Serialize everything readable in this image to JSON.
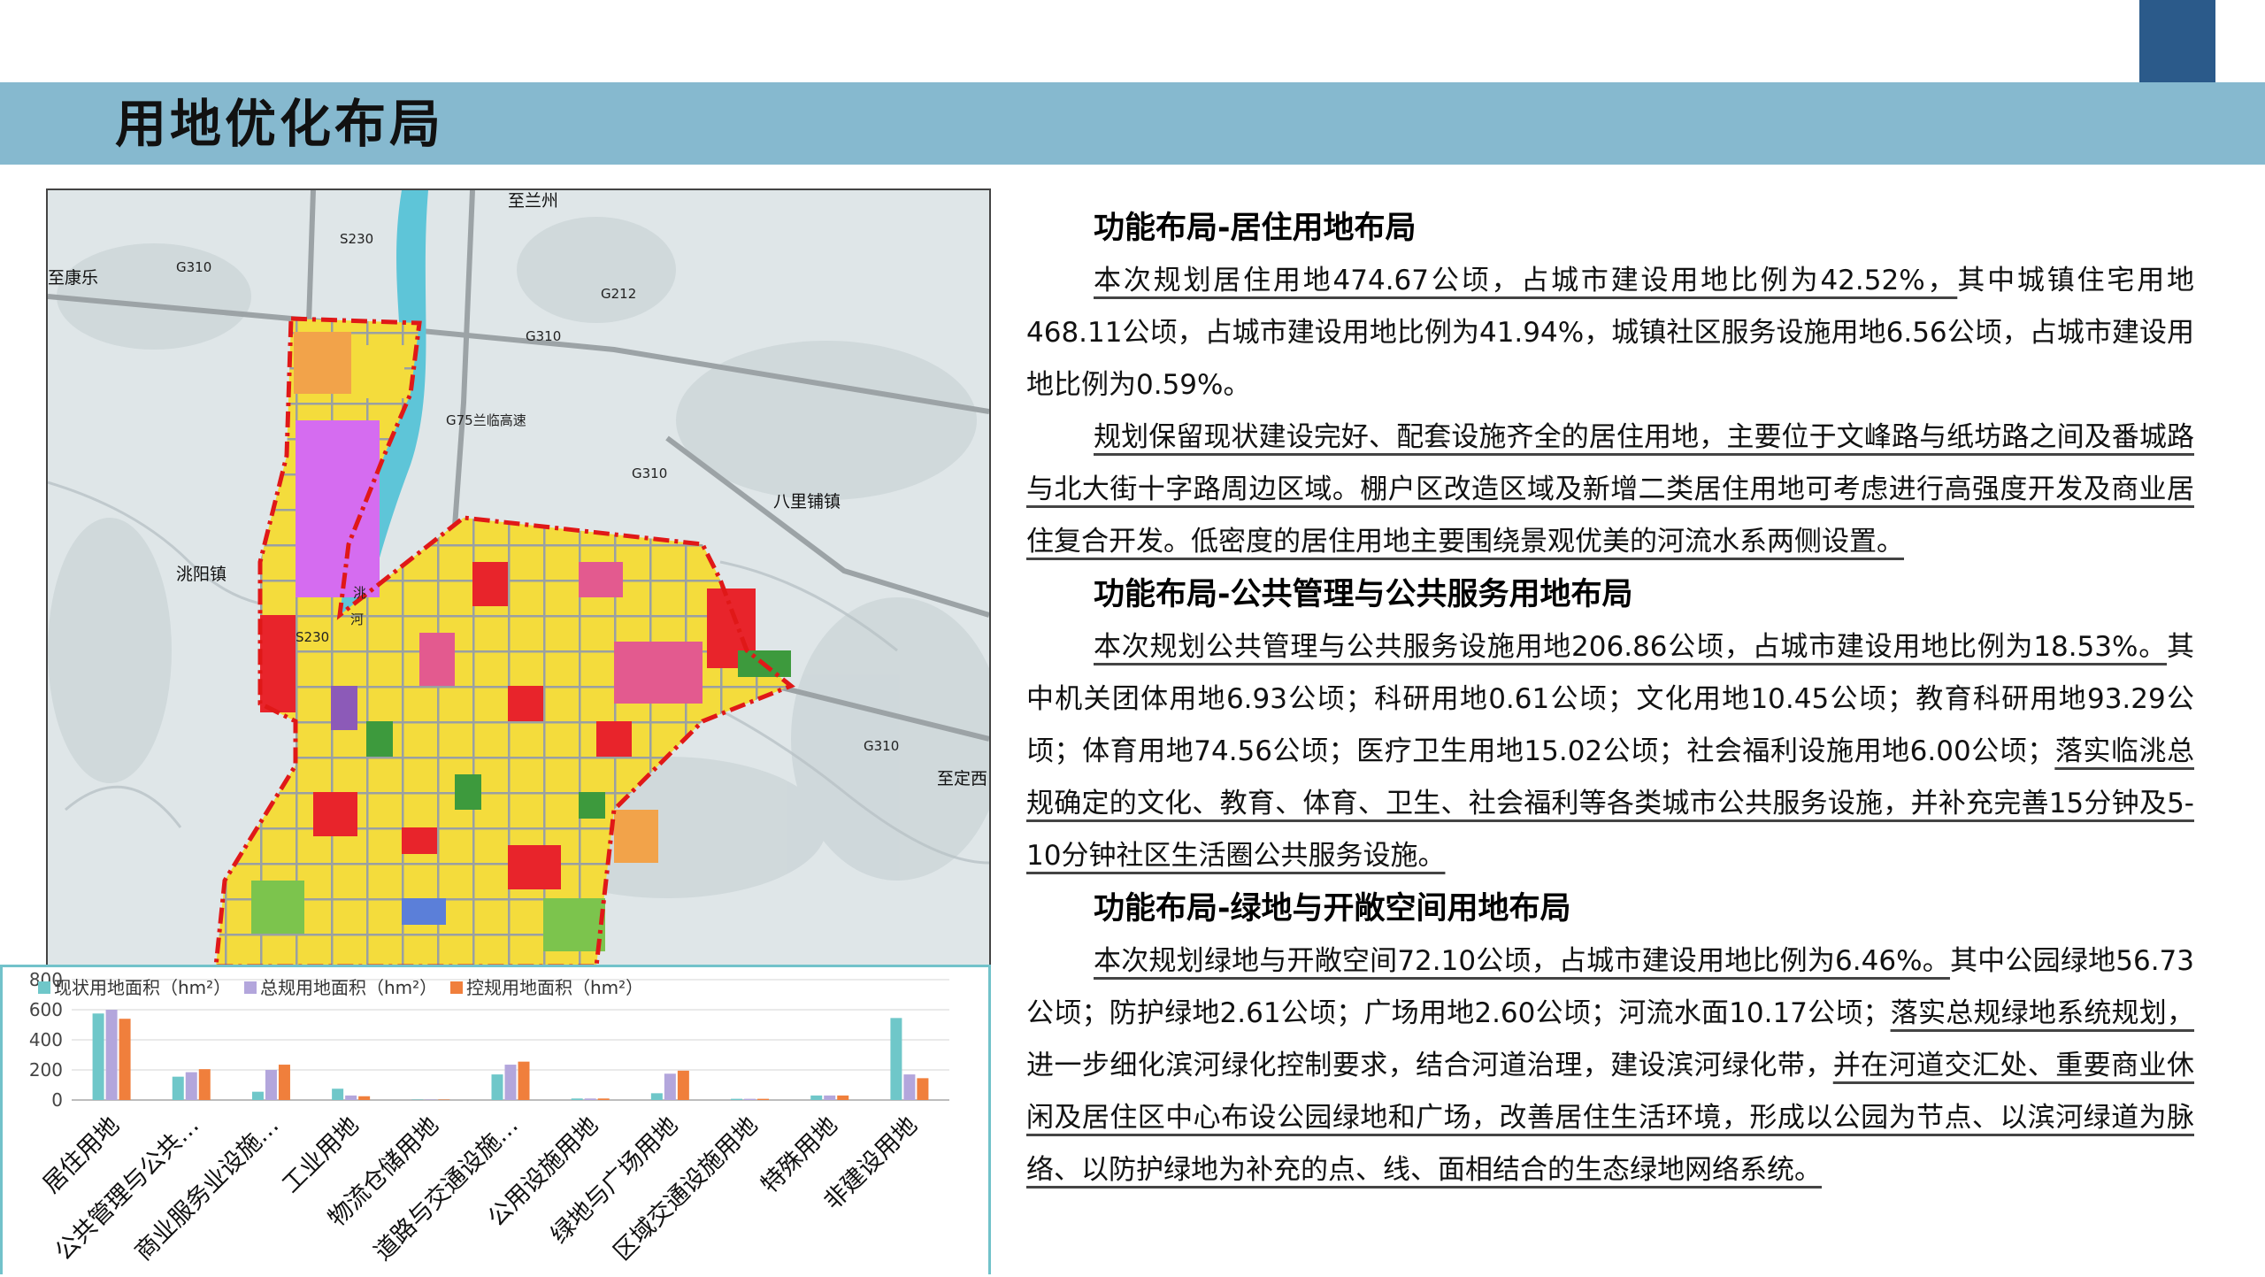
{
  "page": {
    "title": "用地优化布局"
  },
  "map": {
    "labels": [
      "至兰州",
      "S230",
      "G310",
      "至康乐",
      "G212",
      "G310",
      "G75兰临高速",
      "G310",
      "八里铺镇",
      "洮阳镇",
      "洮",
      "河",
      "S230",
      "G310",
      "至定西"
    ]
  },
  "sections": [
    {
      "title": "功能布局-居住用地布局",
      "paragraphs": [
        {
          "parts": [
            {
              "text": "本次规划居住用地474.67公顷，占城市建设用地比例为42.52%，",
              "underline": true
            },
            {
              "text": "其中城镇住宅用地468.11公顷，占城市建设用地比例为41.94%，城镇社区服务设施用地6.56公顷，占城市建设用地比例为0.59%。",
              "underline": false
            }
          ]
        },
        {
          "parts": [
            {
              "text": "规划保留现状建设完好、配套设施齐全的居住用地，主要位于文峰路与纸坊路之间及番城路与北大街十字路周边区域。棚户区改造区域及新增二类居住用地可考虑进行高强度开发及商业居住复合开发。低密度的居住用地主要围绕景观优美的河流水系两侧设置。",
              "underline": true
            }
          ]
        }
      ]
    },
    {
      "title": "功能布局-公共管理与公共服务用地布局",
      "paragraphs": [
        {
          "parts": [
            {
              "text": "本次规划公共管理与公共服务设施用地206.86公顷，占城市建设用地比例为18.53%。",
              "underline": true
            },
            {
              "text": "其中机关团体用地6.93公顷；科研用地0.61公顷；文化用地10.45公顷；教育科研用地93.29公顷；体育用地74.56公顷；医疗卫生用地15.02公顷；社会福利设施用地6.00公顷；",
              "underline": false
            },
            {
              "text": "落实临洮总规确定的文化、教育、体育、卫生、社会福利等各类城市公共服务设施，并补充完善15分钟及5-10分钟社区生活圈公共服务设施。",
              "underline": true
            }
          ]
        }
      ]
    },
    {
      "title": "功能布局-绿地与开敞空间用地布局",
      "paragraphs": [
        {
          "parts": [
            {
              "text": "本次规划绿地与开敞空间72.10公顷，占城市建设用地比例为6.46%。",
              "underline": true
            },
            {
              "text": "其中公园绿地56.73公顷；防护绿地2.61公顷；广场用地2.60公顷；河流水面10.17公顷；",
              "underline": false
            },
            {
              "text": "落实总规绿地系统规划，",
              "underline": true
            },
            {
              "text": "进一步细化滨河绿化控制要求，结合河道治理，建设滨河绿化带，",
              "underline": false
            },
            {
              "text": "并在河道交汇处、重要商业休闲及居住区中心布设公园绿地和广场，改善居住生活环境，形成以公园为节点、以滨河绿道为脉络、以防护绿地为补充的点、线、面相结合的生态绿地网络系统。",
              "underline": true
            }
          ]
        }
      ]
    }
  ],
  "chart_data": {
    "type": "bar",
    "categories": [
      "居住用地",
      "公共管理与公共…",
      "商业服务业设施…",
      "工业用地",
      "物流仓储用地",
      "道路与交通设施…",
      "公用设施用地",
      "绿地与广场用地",
      "区域交通设施用地",
      "特殊用地",
      "非建设用地"
    ],
    "series": [
      {
        "name": "现状用地面积（hm²）",
        "color": "#6fc7c9",
        "values": [
          575,
          155,
          55,
          75,
          3,
          170,
          10,
          45,
          8,
          30,
          545
        ]
      },
      {
        "name": "总规用地面积（hm²）",
        "color": "#b3a6dc",
        "values": [
          600,
          185,
          200,
          30,
          3,
          235,
          10,
          175,
          8,
          30,
          170
        ]
      },
      {
        "name": "控规用地面积（hm²）",
        "color": "#f07f3c",
        "values": [
          540,
          205,
          235,
          25,
          3,
          255,
          10,
          195,
          8,
          30,
          145
        ]
      }
    ],
    "ylim": [
      0,
      800
    ],
    "yticks": [
      0,
      200,
      400,
      600,
      800
    ],
    "legend": "top-left",
    "grid": true
  }
}
